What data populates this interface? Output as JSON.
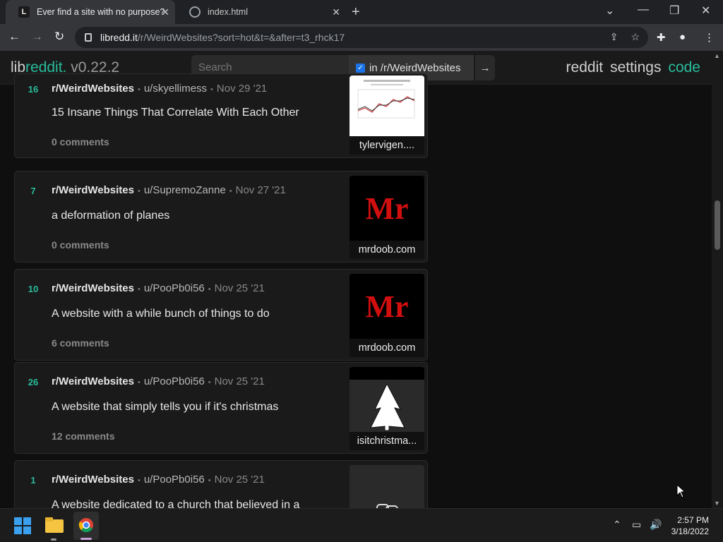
{
  "browser": {
    "tabs": [
      {
        "title": "Ever find a site with no purpose?",
        "active": true,
        "favicon": "L"
      },
      {
        "title": "index.html",
        "active": false
      }
    ],
    "url_domain": "libredd.it",
    "url_path": "/r/WeirdWebsites?sort=hot&t=&after=t3_rhck17"
  },
  "header": {
    "logo_lib": "lib",
    "logo_reddit": "reddit.",
    "logo_version": " v0.22.2",
    "search_placeholder": "Search",
    "restrict_label": "in /r/WeirdWebsites",
    "nav_reddit": "reddit",
    "nav_settings": "settings",
    "nav_code": "code"
  },
  "posts": [
    {
      "score": "16",
      "subreddit": "r/WeirdWebsites",
      "user": "u/skyellimess",
      "date": "Nov 29 '21",
      "title": "15 Insane Things That Correlate With Each Other",
      "comments": "0 comments",
      "domain": "tylervigen....",
      "thumb": "chart"
    },
    {
      "score": "7",
      "subreddit": "r/WeirdWebsites",
      "user": "u/SupremoZanne",
      "date": "Nov 27 '21",
      "title": "a deformation of planes",
      "comments": "0 comments",
      "domain": "mrdoob.com",
      "thumb": "mr",
      "thumb_text": "Mr"
    },
    {
      "score": "10",
      "subreddit": "r/WeirdWebsites",
      "user": "u/PooPb0i56",
      "date": "Nov 25 '21",
      "title": "A website with a while bunch of things to do",
      "comments": "6 comments",
      "domain": "mrdoob.com",
      "thumb": "mr",
      "thumb_text": "Mr"
    },
    {
      "score": "26",
      "subreddit": "r/WeirdWebsites",
      "user": "u/PooPb0i56",
      "date": "Nov 25 '21",
      "title": "A website that simply tells you if it's christmas",
      "comments": "12 comments",
      "domain": "isitchristma...",
      "thumb": "tree"
    },
    {
      "score": "1",
      "subreddit": "r/WeirdWebsites",
      "user": "u/PooPb0i56",
      "date": "Nov 25 '21",
      "title": "A website dedicated to a church that believed in a",
      "comments": "",
      "domain": "",
      "thumb": "link"
    }
  ],
  "taskbar": {
    "time": "2:57 PM",
    "date": "3/18/2022"
  },
  "colors": {
    "accent": "#29bc9b",
    "background": "#0f0f0f",
    "card": "#1a1a1a"
  }
}
